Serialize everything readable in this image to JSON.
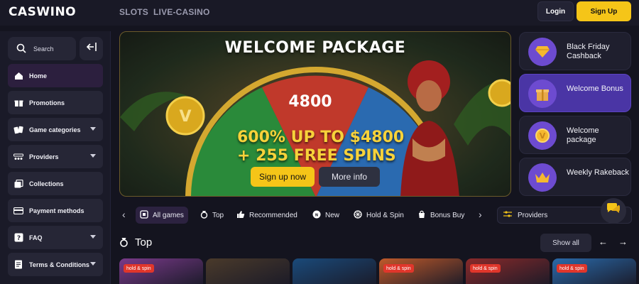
{
  "header": {
    "logo": "CASWINO",
    "nav": [
      "SLOTS",
      "LIVE-CASINO"
    ],
    "login_label": "Login",
    "signup_label": "Sign Up"
  },
  "sidebar": {
    "search_label": "Search",
    "items": [
      {
        "label": "Home",
        "icon": "home-icon",
        "expandable": false
      },
      {
        "label": "Promotions",
        "icon": "gift-icon",
        "expandable": false
      },
      {
        "label": "Game categories",
        "icon": "cards-icon",
        "expandable": true
      },
      {
        "label": "Providers",
        "icon": "providers-icon",
        "expandable": true
      },
      {
        "label": "Collections",
        "icon": "collections-icon",
        "expandable": false
      },
      {
        "label": "Payment methods",
        "icon": "card-icon",
        "expandable": false
      },
      {
        "label": "FAQ",
        "icon": "question-icon",
        "expandable": true
      },
      {
        "label": "Terms & Conditions",
        "icon": "document-icon",
        "expandable": true
      }
    ]
  },
  "banner": {
    "title": "WELCOME PACKAGE",
    "offer_line1": "600% UP TO $4800",
    "offer_line2": "+ 255 FREE SPINS",
    "wheel_value": "4800",
    "signup_label": "Sign up now",
    "info_label": "More info"
  },
  "promos": [
    {
      "label": "Black Friday Cashback",
      "icon": "diamond-icon",
      "highlighted": false
    },
    {
      "label": "Welcome Bonus",
      "icon": "gift-box-icon",
      "highlighted": true
    },
    {
      "label": "Welcome package",
      "icon": "coin-icon",
      "highlighted": false
    },
    {
      "label": "Weekly Rakeback",
      "icon": "crown-icon",
      "highlighted": false
    }
  ],
  "categories": [
    {
      "label": "All games",
      "icon": "all-games-icon",
      "active": true
    },
    {
      "label": "Top",
      "icon": "top-icon",
      "active": false
    },
    {
      "label": "Recommended",
      "icon": "thumbs-up-icon",
      "active": false
    },
    {
      "label": "New",
      "icon": "new-icon",
      "active": false
    },
    {
      "label": "Hold & Spin",
      "icon": "hold-spin-icon",
      "active": false
    },
    {
      "label": "Bonus Buy",
      "icon": "bonus-buy-icon",
      "active": false
    }
  ],
  "providers_label": "Providers",
  "section": {
    "title": "Top",
    "show_all_label": "Show all"
  },
  "tiles": [
    {
      "badge": "hold & spin",
      "color": "#7a3a8a"
    },
    {
      "badge": "",
      "color": "#4a3a2a"
    },
    {
      "badge": "",
      "color": "#1a4a7a"
    },
    {
      "badge": "hold & spin",
      "color": "#c05a2a"
    },
    {
      "badge": "hold & spin",
      "color": "#8a2a2a"
    },
    {
      "badge": "hold & spin",
      "color": "#2a6aaa"
    }
  ],
  "colors": {
    "accent": "#f5c518",
    "promo_highlight": "#4a35a5",
    "background": "#14141f"
  }
}
